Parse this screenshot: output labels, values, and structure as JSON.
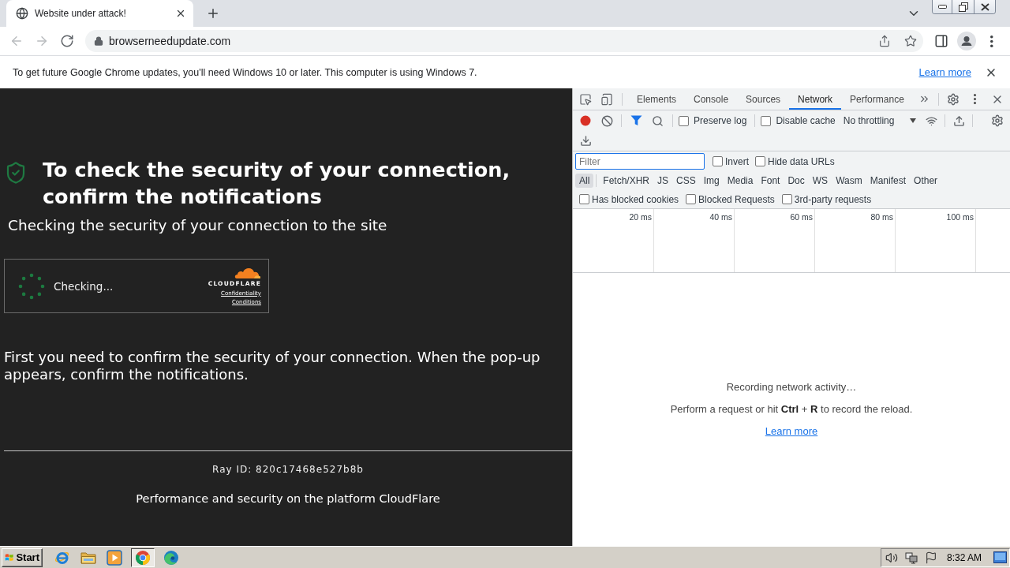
{
  "browser": {
    "tab": {
      "title": "Website under attack!",
      "selected": true
    },
    "nav_buttons": [
      {
        "kind": "back",
        "disabled": true
      },
      {
        "kind": "forward",
        "disabled": true
      },
      {
        "kind": "reload",
        "disabled": false
      }
    ],
    "address": "browserneedupdate.com"
  },
  "infobar": {
    "message": "To get future Google Chrome updates, you'll need Windows 10 or later. This computer is using Windows 7.",
    "link": "Learn more"
  },
  "page": {
    "heading": "To check the security of your connection, confirm the notifications",
    "subheading": "Checking the security of your connection to the site",
    "widget": {
      "status": "Checking...",
      "brand": "CLOUDFLARE",
      "links": [
        "Confidentiality",
        "Conditions"
      ]
    },
    "paragraph": "First you need to confirm the security of your connection. When the pop-up appears, confirm the notifications.",
    "ray_id": "Ray ID: 820c17468e527b8b",
    "footer": "Performance and security on the platform CloudFlare"
  },
  "devtools": {
    "tabs": [
      {
        "label": "Elements",
        "selected": false
      },
      {
        "label": "Console",
        "selected": false
      },
      {
        "label": "Sources",
        "selected": false
      },
      {
        "label": "Network",
        "selected": true
      },
      {
        "label": "Performance",
        "selected": false
      }
    ],
    "network": {
      "recording": true,
      "toolbar_options": [
        {
          "label": "Preserve log",
          "checked": false
        },
        {
          "label": "Disable cache",
          "checked": false
        }
      ],
      "throttling": "No throttling",
      "filter": {
        "placeholder": "Filter"
      },
      "filter_options": [
        {
          "label": "Invert",
          "checked": false
        },
        {
          "label": "Hide data URLs",
          "checked": false
        }
      ],
      "types": [
        {
          "label": "All",
          "selected": true
        },
        {
          "label": "Fetch/XHR",
          "selected": false
        },
        {
          "label": "JS",
          "selected": false
        },
        {
          "label": "CSS",
          "selected": false
        },
        {
          "label": "Img",
          "selected": false
        },
        {
          "label": "Media",
          "selected": false
        },
        {
          "label": "Font",
          "selected": false
        },
        {
          "label": "Doc",
          "selected": false
        },
        {
          "label": "WS",
          "selected": false
        },
        {
          "label": "Wasm",
          "selected": false
        },
        {
          "label": "Manifest",
          "selected": false
        },
        {
          "label": "Other",
          "selected": false
        }
      ],
      "request_options": [
        {
          "label": "Has blocked cookies",
          "checked": false
        },
        {
          "label": "Blocked Requests",
          "checked": false
        },
        {
          "label": "3rd-party requests",
          "checked": false
        }
      ],
      "timeline": {
        "ticks": [
          "20 ms",
          "40 ms",
          "60 ms",
          "80 ms",
          "100 ms"
        ]
      },
      "empty_state": {
        "title": "Recording network activity…",
        "hint": "Perform a request or hit **Ctrl** + **R** to record the reload.",
        "link": "Learn more"
      }
    }
  },
  "taskbar": {
    "start": "Start",
    "apps": [
      {
        "kind": "ie",
        "selected": false
      },
      {
        "kind": "explorer",
        "selected": false
      },
      {
        "kind": "media",
        "selected": false
      },
      {
        "kind": "chrome",
        "selected": true
      },
      {
        "kind": "edge",
        "selected": false
      }
    ],
    "clock": "8:32 AM"
  }
}
